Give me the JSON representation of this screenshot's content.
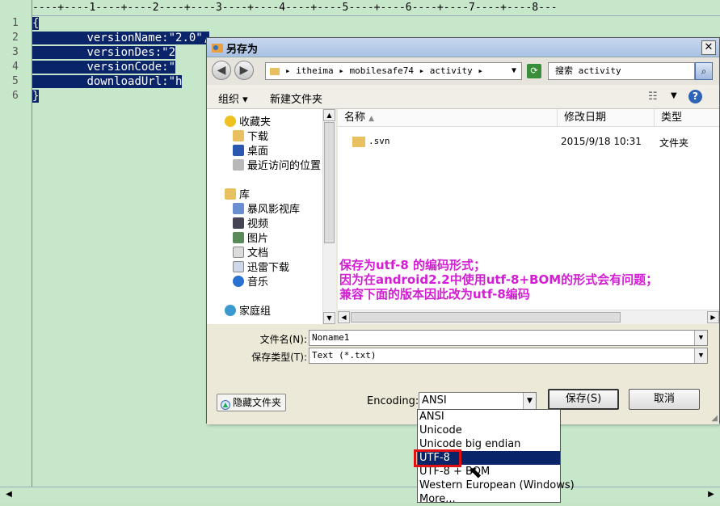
{
  "editor": {
    "ruler": "----+----1----+----2----+----3----+----4----+----5----+----6----+----7----+----8---",
    "line_numbers": [
      "1",
      "2",
      "3",
      "4",
      "5",
      "6"
    ],
    "lines": [
      "{",
      "\tversionName:\"2.0\",",
      "\tversionDes:\"2",
      "\tversionCode:\"",
      "\tdownloadUrl:\"h",
      "}"
    ]
  },
  "dialog": {
    "title": "另存为",
    "address_path": "▸ itheima ▸ mobilesafe74 ▸ activity ▸",
    "search_placeholder": "搜索 activity",
    "toolbar": {
      "organize": "组织 ▾",
      "new_folder": "新建文件夹"
    },
    "nav": {
      "favorites": "收藏夹",
      "downloads": "下载",
      "desktop": "桌面",
      "recent": "最近访问的位置",
      "libraries": "库",
      "storm": "暴风影视库",
      "videos": "视频",
      "pictures": "图片",
      "documents": "文档",
      "thunder": "迅雷下载",
      "music": "音乐",
      "homegroup": "家庭组"
    },
    "columns": {
      "name": "名称",
      "date": "修改日期",
      "type": "类型"
    },
    "files": [
      {
        "name": ".svn",
        "date": "2015/9/18 10:31",
        "type": "文件夹"
      }
    ],
    "annotation": [
      "保存为utf-8 的编码形式；",
      "因为在android2.2中使用utf-8+BOM的形式会有问题；",
      "兼容下面的版本因此改为utf-8编码"
    ],
    "filename_label": "文件名(N):",
    "filename_value": "Noname1",
    "filetype_label": "保存类型(T):",
    "filetype_value": "Text (*.txt)",
    "hide_folders": "隐藏文件夹",
    "encoding_label": "Encoding:",
    "encoding_value": "ANSI",
    "save": "保存(S)",
    "cancel": "取消"
  },
  "encoding_options": [
    "ANSI",
    "Unicode",
    "Unicode big endian",
    "UTF-8",
    "UTF-8 + BOM",
    "Western European (Windows)",
    "More..."
  ],
  "selected_encoding": "UTF-8",
  "colors": {
    "editor_bg": "#c7e7cb",
    "selection": "#0a246a",
    "annotation": "#d21ed2",
    "highlight_box": "#e01010"
  }
}
